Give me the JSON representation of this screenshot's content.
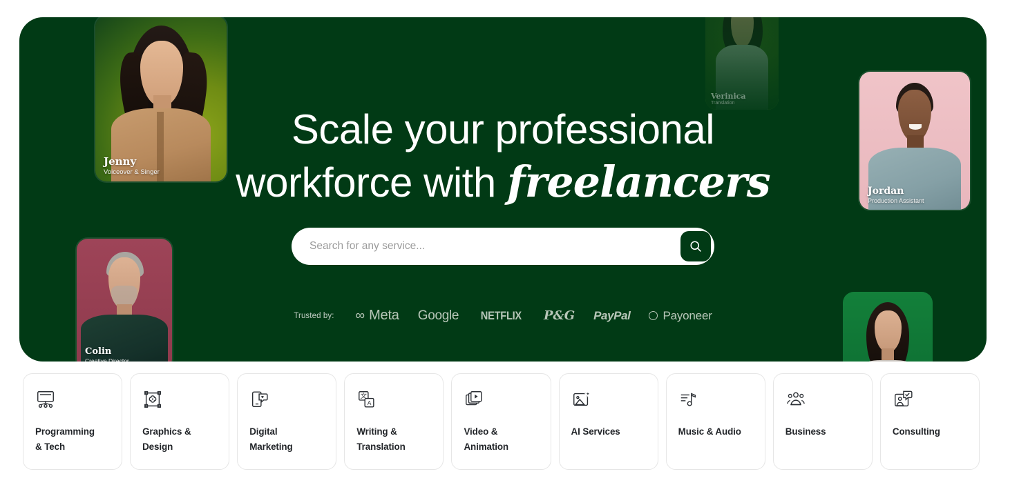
{
  "hero": {
    "headline_line1": "Scale your professional",
    "headline_line2_prefix": "workforce with ",
    "headline_line2_italic": "freelancers",
    "background_color": "#013a15"
  },
  "search": {
    "placeholder": "Search for any service...",
    "value": "",
    "button_icon": "search-icon",
    "button_color": "#013a15"
  },
  "trusted_by": {
    "label": "Trusted by:",
    "brands": [
      {
        "name": "Meta",
        "glyph": "∞"
      },
      {
        "name": "Google"
      },
      {
        "name": "NETFLIX"
      },
      {
        "name": "P&G"
      },
      {
        "name": "PayPal"
      },
      {
        "name": "Payoneer",
        "glyph": "circle"
      }
    ]
  },
  "freelancer_cards": [
    {
      "name": "Jenny",
      "role": "Voiceover & Singer",
      "bg_color": "#6f8c14"
    },
    {
      "name": "Verinica",
      "role": "Translation",
      "bg_color": "#3a6a1a"
    },
    {
      "name": "Jordan",
      "role": "Production Assistant",
      "bg_color": "#f0c4c8"
    },
    {
      "name": "Colin",
      "role": "Creative Director",
      "bg_color": "#9e4458"
    },
    {
      "name": "",
      "role": "",
      "bg_color": "#13803a"
    }
  ],
  "categories": [
    {
      "label": "Programming\n& Tech",
      "icon": "monitor-nodes-icon"
    },
    {
      "label": "Graphics &\nDesign",
      "icon": "design-bounding-box-icon"
    },
    {
      "label": "Digital\nMarketing",
      "icon": "phone-chat-icon"
    },
    {
      "label": "Writing &\nTranslation",
      "icon": "translate-icon"
    },
    {
      "label": "Video &\nAnimation",
      "icon": "video-play-icon"
    },
    {
      "label": "AI Services",
      "icon": "image-sparkle-icon"
    },
    {
      "label": "Music & Audio",
      "icon": "music-note-icon"
    },
    {
      "label": "Business",
      "icon": "people-group-icon"
    },
    {
      "label": "Consulting",
      "icon": "person-check-icon"
    }
  ]
}
